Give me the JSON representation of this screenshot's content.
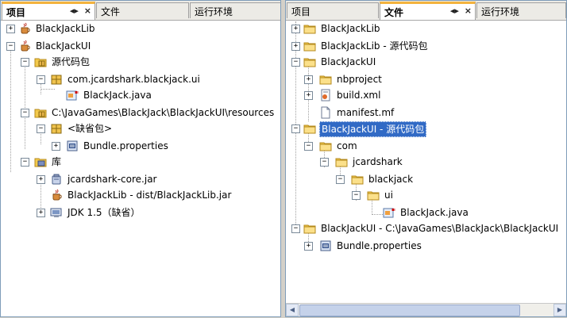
{
  "left_panel": {
    "tabs": [
      {
        "label": "项目",
        "active": true
      },
      {
        "label": "文件",
        "active": false
      },
      {
        "label": "运行环境",
        "active": false
      }
    ],
    "nodes": [
      {
        "label": "BlackJackLib",
        "icon": "java-project-icon",
        "toggle": "+"
      },
      {
        "label": "BlackJackUI",
        "icon": "java-project-icon",
        "toggle": "-"
      },
      {
        "label": "源代码包",
        "icon": "source-packages-icon",
        "toggle": "-"
      },
      {
        "label": "com.jcardshark.blackjack.ui",
        "icon": "package-icon",
        "toggle": "-"
      },
      {
        "label": "BlackJack.java",
        "icon": "java-form-icon",
        "toggle": ""
      },
      {
        "label": "C:\\JavaGames\\BlackJack\\BlackJackUI\\resources",
        "icon": "source-packages-icon",
        "toggle": "-"
      },
      {
        "label": "<缺省包>",
        "icon": "package-icon",
        "toggle": "-"
      },
      {
        "label": "Bundle.properties",
        "icon": "properties-icon",
        "toggle": "+"
      },
      {
        "label": "库",
        "icon": "libraries-icon",
        "toggle": "-"
      },
      {
        "label": "jcardshark-core.jar",
        "icon": "jar-icon",
        "toggle": "+"
      },
      {
        "label": "BlackJackLib - dist/BlackJackLib.jar",
        "icon": "java-project-icon",
        "toggle": ""
      },
      {
        "label": "JDK 1.5（缺省）",
        "icon": "jdk-icon",
        "toggle": "+"
      }
    ]
  },
  "right_panel": {
    "tabs": [
      {
        "label": "项目",
        "active": false
      },
      {
        "label": "文件",
        "active": true
      },
      {
        "label": "运行环境",
        "active": false
      }
    ],
    "nodes": [
      {
        "label": "BlackJackLib",
        "icon": "folder-icon",
        "toggle": "+"
      },
      {
        "label": "BlackJackLib - 源代码包",
        "icon": "folder-icon",
        "toggle": "+"
      },
      {
        "label": "BlackJackUI",
        "icon": "folder-icon",
        "toggle": "-"
      },
      {
        "label": "nbproject",
        "icon": "folder-icon",
        "toggle": "+"
      },
      {
        "label": "build.xml",
        "icon": "build-xml-icon",
        "toggle": "+"
      },
      {
        "label": "manifest.mf",
        "icon": "file-icon",
        "toggle": ""
      },
      {
        "label": "BlackJackUI - 源代码包",
        "icon": "folder-icon",
        "toggle": "-",
        "selected": true
      },
      {
        "label": "com",
        "icon": "folder-icon",
        "toggle": "-"
      },
      {
        "label": "jcardshark",
        "icon": "folder-icon",
        "toggle": "-"
      },
      {
        "label": "blackjack",
        "icon": "folder-icon",
        "toggle": "-"
      },
      {
        "label": "ui",
        "icon": "folder-icon",
        "toggle": "-"
      },
      {
        "label": "BlackJack.java",
        "icon": "java-form-icon",
        "toggle": ""
      },
      {
        "label": "BlackJackUI - C:\\JavaGames\\BlackJack\\BlackJackUI",
        "icon": "folder-icon",
        "toggle": "-"
      },
      {
        "label": "Bundle.properties",
        "icon": "properties-icon",
        "toggle": "+"
      }
    ]
  },
  "tab_controls": {
    "minimize": "◂▸",
    "close": "×"
  },
  "scroll": {
    "left_arrow": "◀",
    "right_arrow": "▶"
  },
  "colors": {
    "selection": "#316ac5",
    "active_tab_accent": "#f3b33d",
    "folder": "#f3c94b"
  }
}
